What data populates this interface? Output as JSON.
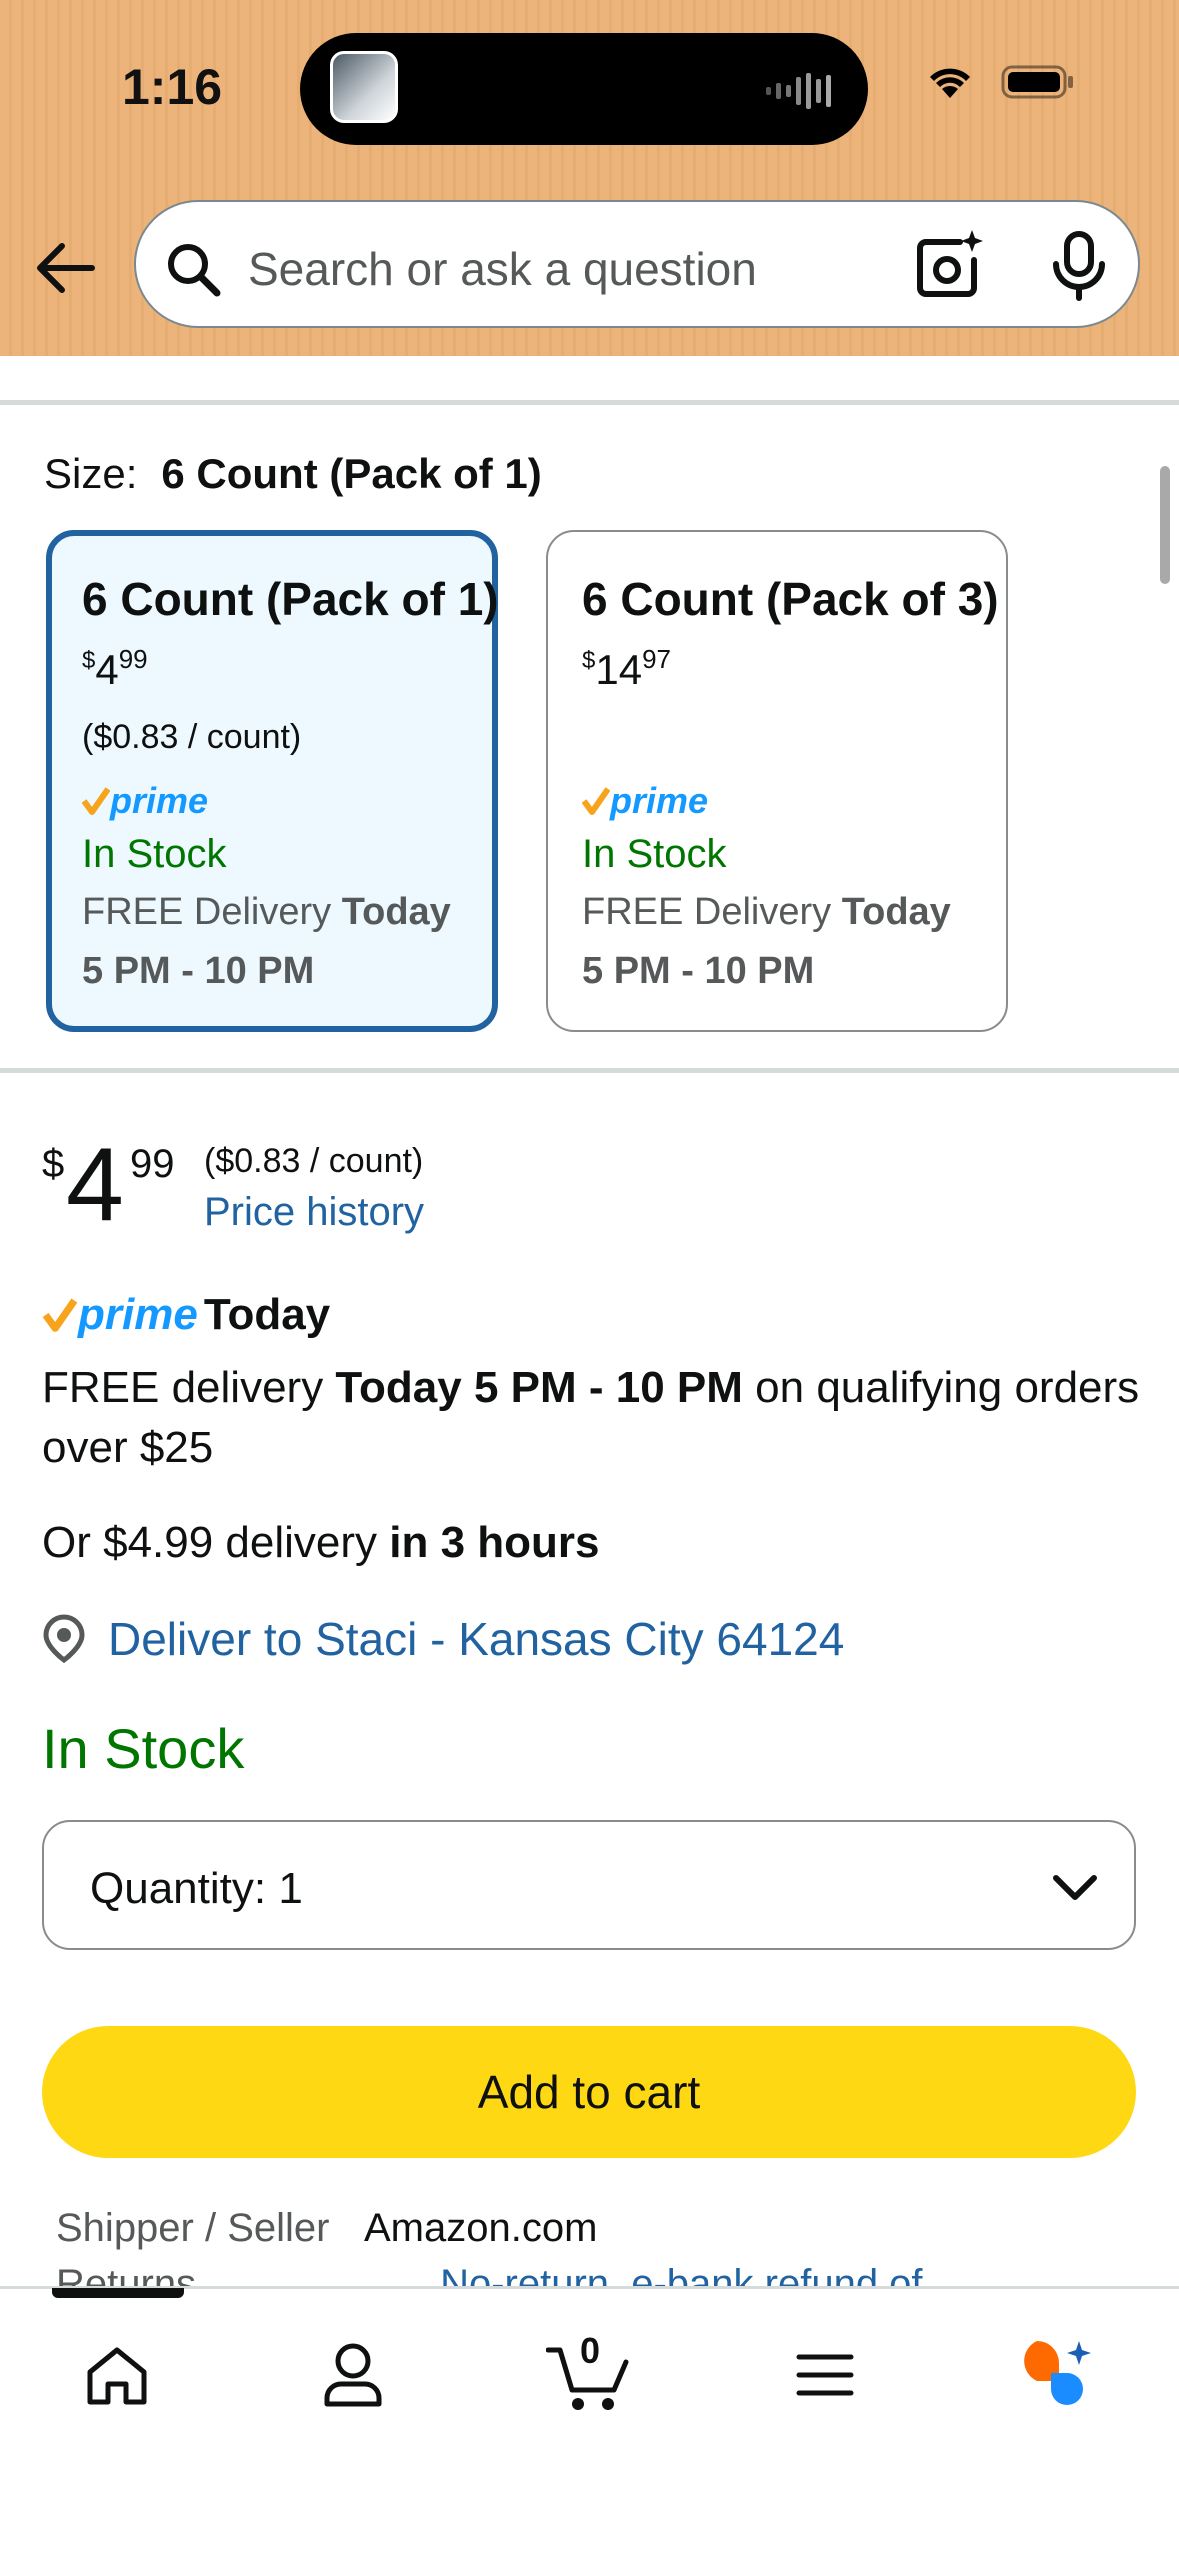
{
  "status_bar": {
    "time": "1:16"
  },
  "search": {
    "placeholder": "Search or ask a question"
  },
  "size_selector": {
    "label": "Size:",
    "selected_value": "6 Count (Pack of 1)",
    "options": [
      {
        "title": "6 Count (Pack of 1)",
        "price_whole": "4",
        "price_fraction": "99",
        "price_symbol": "$",
        "unit_price": "($0.83 / count)",
        "prime": "prime",
        "stock": "In Stock",
        "delivery_prefix": "FREE Delivery ",
        "delivery_day": "Today",
        "delivery_window": "5 PM - 10 PM",
        "selected": true
      },
      {
        "title": "6 Count (Pack of 3)",
        "price_whole": "14",
        "price_fraction": "97",
        "price_symbol": "$",
        "unit_price": "",
        "prime": "prime",
        "stock": "In Stock",
        "delivery_prefix": "FREE Delivery ",
        "delivery_day": "Today",
        "delivery_window": "5 PM - 10 PM",
        "selected": false
      }
    ]
  },
  "buybox": {
    "price_symbol": "$",
    "price_whole": "4",
    "price_fraction": "99",
    "unit_price": "($0.83 / count)",
    "price_history_link": "Price history",
    "prime_word": "prime",
    "prime_today": "Today",
    "free_delivery_prefix": "FREE delivery ",
    "free_delivery_bold": "Today 5 PM - 10 PM",
    "free_delivery_suffix": " on qualifying orders over $25",
    "alt_delivery_prefix": "Or $4.99 delivery ",
    "alt_delivery_bold": "in 3 hours",
    "deliver_to": "Deliver to Staci - Kansas City 64124",
    "stock": "In Stock",
    "quantity_label": "Quantity:",
    "quantity_value": "1",
    "add_to_cart": "Add to cart",
    "shipper_label": "Shipper / Seller",
    "shipper_value": "Amazon.com",
    "next_row_label": "Returns",
    "next_row_value": "No-return, e-bank refund of ..."
  },
  "bottom_nav": {
    "items": [
      "home-icon",
      "account-icon",
      "cart-icon",
      "menu-icon",
      "rufus-icon"
    ],
    "cart_count": "0",
    "active_index": 0
  },
  "colors": {
    "header_bg": "#ecb47a",
    "link_blue": "#2162a1",
    "stock_green": "#007600",
    "cart_yellow": "#ffd814",
    "prime_blue": "#1399ff",
    "prime_orange": "#f7a31c",
    "selected_card_bg": "#edf8ff",
    "selected_card_border": "#2162a1"
  }
}
